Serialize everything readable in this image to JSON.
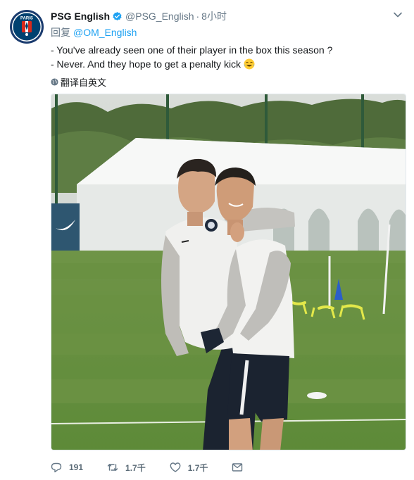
{
  "tweet": {
    "author_name": "PSG English",
    "handle": "@PSG_English",
    "separator": "·",
    "time": "8小时",
    "reply_prefix": "回复",
    "reply_to": "@OM_English",
    "lines": [
      "- You've already seen one of their player in the box this season ?",
      "- Never. And they hope to get a penalty kick"
    ],
    "translate_label": "翻译自英文",
    "avatar_text": "PARIS"
  },
  "actions": {
    "replies": "191",
    "retweets": "1.7千",
    "likes": "1.7千"
  },
  "icons": {
    "verified": "verified-badge-icon",
    "caret": "chevron-down-icon",
    "globe": "globe-icon",
    "reply": "reply-icon",
    "retweet": "retweet-icon",
    "like": "heart-icon",
    "dm": "envelope-icon",
    "emoji": "tears-of-joy-emoji"
  },
  "colors": {
    "link": "#1da1f2",
    "muted": "#657786",
    "psg_navy": "#004170",
    "psg_red": "#da291c"
  }
}
